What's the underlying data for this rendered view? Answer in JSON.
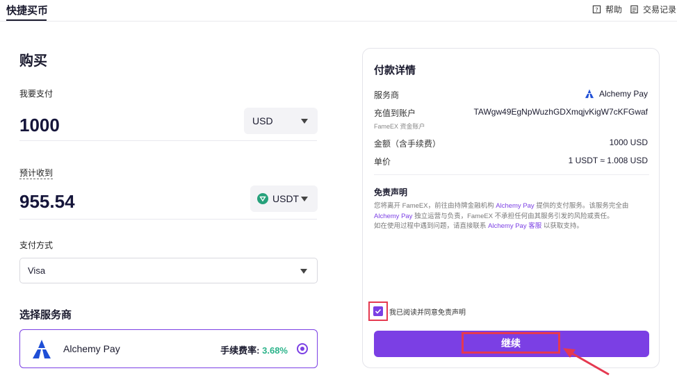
{
  "header": {
    "active_tab": "快捷买币",
    "help": "帮助",
    "history": "交易记录"
  },
  "buy": {
    "title": "购买",
    "pay_label": "我要支付",
    "pay_amount": "1000",
    "pay_currency": "USD",
    "receive_label": "预计收到",
    "receive_amount": "955.54",
    "receive_currency": "USDT",
    "method_label": "支付方式",
    "method_value": "Visa",
    "provider_section": "选择服务商",
    "provider": {
      "name": "Alchemy Pay",
      "fee_label": "手续费率:",
      "fee_value": "3.68%",
      "selected": true
    }
  },
  "payment_details": {
    "title": "付款详情",
    "rows": [
      {
        "label": "服务商",
        "value": "Alchemy Pay"
      },
      {
        "label": "充值到账户",
        "value": "TAWgw49EgNpWuzhGDXmqjvKigW7cKFGwaf",
        "sub": "FameEX 资金账户"
      },
      {
        "label": "金额（含手续费）",
        "value": "1000 USD"
      },
      {
        "label": "单价",
        "value": "1 USDT ≈ 1.008 USD"
      }
    ],
    "disclaimer_title": "免责声明",
    "disclaimer_p1": "您将离开 FameEX，前往由持牌金融机构 ",
    "disclaimer_p1_link": "Alchemy Pay",
    "disclaimer_p1_end": " 提供的支付服务。该服务完全由",
    "disclaimer_p2_link": "Alchemy Pay",
    "disclaimer_p2": " 独立运营与负责，FameEX 不承担任何由其服务引发的风险或责任。",
    "disclaimer_p3": "如在使用过程中遇到问题，请直接联系 ",
    "disclaimer_p3_link": "Alchemy Pay 客服",
    "disclaimer_p3_end": " 以获取支持。",
    "agree_label": "我已阅读并同意免责声明",
    "agree_checked": true,
    "continue_label": "继续"
  },
  "colors": {
    "accent": "#7b3fe4",
    "highlight": "#e53950",
    "fee_green": "#2bb38a"
  }
}
